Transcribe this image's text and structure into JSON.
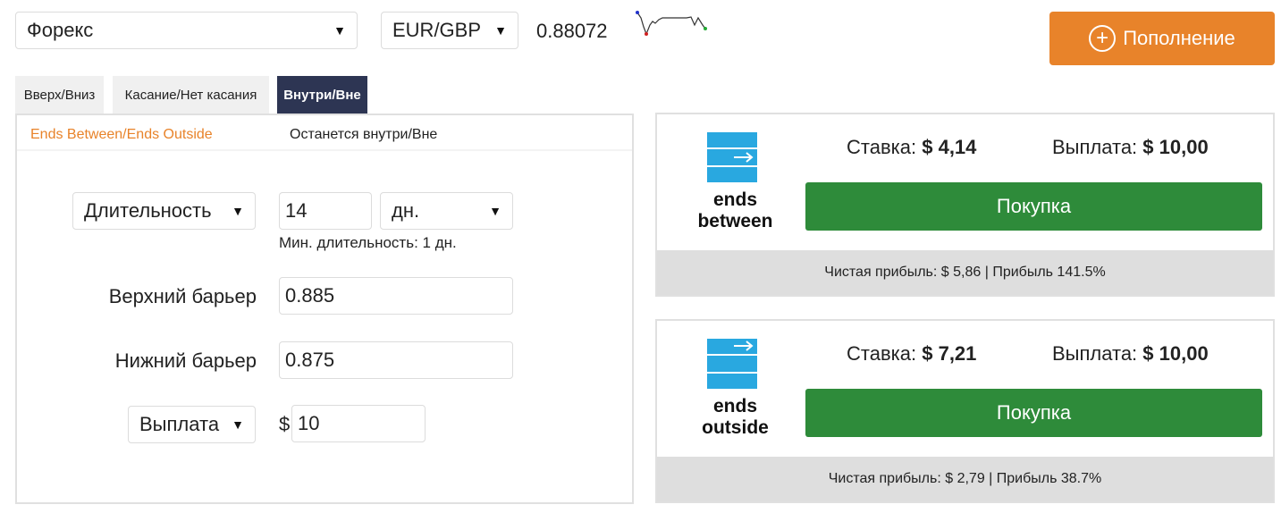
{
  "header": {
    "market_select": {
      "value": "Форекс"
    },
    "pair_select": {
      "value": "EUR/GBP"
    },
    "price": "0.88072",
    "deposit_button": "Пополнение"
  },
  "tabs": [
    {
      "label": "Вверх/Вниз",
      "active": false
    },
    {
      "label": "Касание/Нет касания",
      "active": false
    },
    {
      "label": "Внутри/Вне",
      "active": true
    }
  ],
  "subtabs": [
    {
      "label": "Ends Between/Ends Outside",
      "active": true
    },
    {
      "label": "Останется внутри/Вне",
      "active": false
    }
  ],
  "form": {
    "duration_select": "Длительность",
    "duration_value": "14",
    "duration_unit": "дн.",
    "min_duration_note": "Мин. длительность: 1 дн.",
    "upper_barrier_label": "Верхний барьер",
    "upper_barrier_value": "0.885",
    "lower_barrier_label": "Нижний барьер",
    "lower_barrier_value": "0.875",
    "payout_select": "Выплата",
    "currency_symbol": "$",
    "payout_value": "10"
  },
  "contracts": [
    {
      "name_line1": "ends",
      "name_line2": "between",
      "stake_label": "Ставка:",
      "stake_value": "$ 4,14",
      "payout_label": "Выплата:",
      "payout_value": "$ 10,00",
      "buy_label": "Покупка",
      "profit_text": "Чистая прибыль: $ 5,86 | Прибыль 141.5%"
    },
    {
      "name_line1": "ends",
      "name_line2": "outside",
      "stake_label": "Ставка:",
      "stake_value": "$ 7,21",
      "payout_label": "Выплата:",
      "payout_value": "$ 10,00",
      "buy_label": "Покупка",
      "profit_text": "Чистая прибыль: $ 2,79 | Прибыль 38.7%"
    }
  ],
  "colors": {
    "accent_orange": "#e8832a",
    "buy_green": "#2e8b3a",
    "active_tab": "#2d3553",
    "icon_blue": "#29a8e0"
  },
  "icons": {
    "dropdown": "caret-down-icon",
    "deposit": "plus-circle-icon",
    "sparkline": "sparkline-chart-icon",
    "contract_between": "ends-between-icon",
    "contract_outside": "ends-outside-icon"
  }
}
